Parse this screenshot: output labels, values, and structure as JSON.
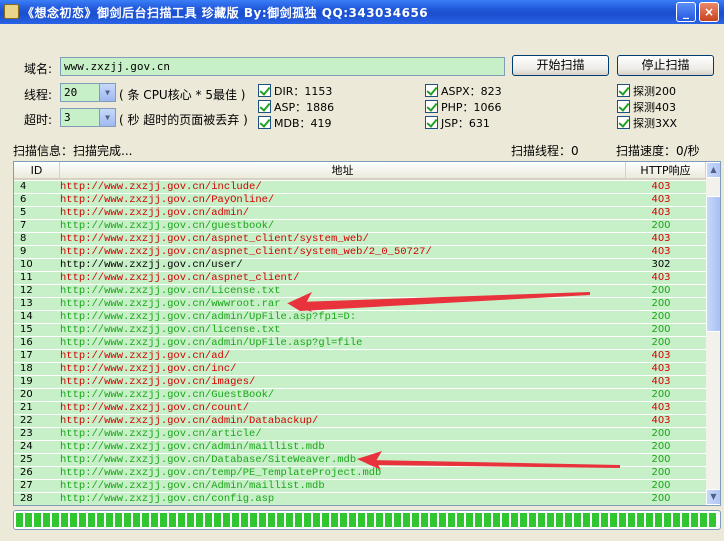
{
  "window": {
    "title": "《想念初恋》御剑后台扫描工具 珍藏版 By:御剑孤独 QQ:343034656",
    "min_label": "_",
    "close_label": "×"
  },
  "form": {
    "domain_label": "域名:",
    "domain_value": "www.zxzjj.gov.cn",
    "threads_label": "线程:",
    "threads_value": "20",
    "threads_hint": "( 条 CPU核心 * 5最佳 )",
    "timeout_label": "超时:",
    "timeout_value": "3",
    "timeout_hint": "( 秒 超时的页面被丢弃 )",
    "start_button": "开始扫描",
    "stop_button": "停止扫描"
  },
  "checkboxes": {
    "dir": "DIR：1153",
    "asp": "ASP：1886",
    "mdb": "MDB：419",
    "aspx": "ASPX：823",
    "php": "PHP：1066",
    "jsp": "JSP：631",
    "probe200": "探测200",
    "probe403": "探测403",
    "probe3xx": "探测3XX"
  },
  "status": {
    "info": "扫描信息：扫描完成...",
    "threads": "扫描线程：0",
    "speed": "扫描速度：0/秒"
  },
  "list": {
    "headers": [
      "ID",
      "地址",
      "HTTP响应"
    ],
    "rows": [
      {
        "id": "4",
        "url": "http://www.zxzjj.gov.cn/include/",
        "code": "403"
      },
      {
        "id": "6",
        "url": "http://www.zxzjj.gov.cn/PayOnline/",
        "code": "403"
      },
      {
        "id": "5",
        "url": "http://www.zxzjj.gov.cn/admin/",
        "code": "403"
      },
      {
        "id": "7",
        "url": "http://www.zxzjj.gov.cn/guestbook/",
        "code": "200"
      },
      {
        "id": "8",
        "url": "http://www.zxzjj.gov.cn/aspnet_client/system_web/",
        "code": "403"
      },
      {
        "id": "9",
        "url": "http://www.zxzjj.gov.cn/aspnet_client/system_web/2_0_50727/",
        "code": "403"
      },
      {
        "id": "10",
        "url": "http://www.zxzjj.gov.cn/user/",
        "code": "302"
      },
      {
        "id": "11",
        "url": "http://www.zxzjj.gov.cn/aspnet_client/",
        "code": "403"
      },
      {
        "id": "12",
        "url": "http://www.zxzjj.gov.cn/License.txt",
        "code": "200"
      },
      {
        "id": "13",
        "url": "http://www.zxzjj.gov.cn/wwwroot.rar",
        "code": "200"
      },
      {
        "id": "14",
        "url": "http://www.zxzjj.gov.cn/admin/UpFile.asp?fp1=D:",
        "code": "200"
      },
      {
        "id": "15",
        "url": "http://www.zxzjj.gov.cn/license.txt",
        "code": "200"
      },
      {
        "id": "16",
        "url": "http://www.zxzjj.gov.cn/admin/UpFile.asp?gl=file",
        "code": "200"
      },
      {
        "id": "17",
        "url": "http://www.zxzjj.gov.cn/ad/",
        "code": "403"
      },
      {
        "id": "18",
        "url": "http://www.zxzjj.gov.cn/inc/",
        "code": "403"
      },
      {
        "id": "19",
        "url": "http://www.zxzjj.gov.cn/images/",
        "code": "403"
      },
      {
        "id": "20",
        "url": "http://www.zxzjj.gov.cn/GuestBook/",
        "code": "200"
      },
      {
        "id": "21",
        "url": "http://www.zxzjj.gov.cn/count/",
        "code": "403"
      },
      {
        "id": "22",
        "url": "http://www.zxzjj.gov.cn/admin/Databackup/",
        "code": "403"
      },
      {
        "id": "23",
        "url": "http://www.zxzjj.gov.cn/article/",
        "code": "200"
      },
      {
        "id": "24",
        "url": "http://www.zxzjj.gov.cn/admin/maillist.mdb",
        "code": "200"
      },
      {
        "id": "25",
        "url": "http://www.zxzjj.gov.cn/Database/SiteWeaver.mdb",
        "code": "200"
      },
      {
        "id": "26",
        "url": "http://www.zxzjj.gov.cn/temp/PE_TemplateProject.mdb",
        "code": "200"
      },
      {
        "id": "27",
        "url": "http://www.zxzjj.gov.cn/Admin/maillist.mdb",
        "code": "200"
      },
      {
        "id": "28",
        "url": "http://www.zxzjj.gov.cn/config.asp",
        "code": "200"
      }
    ]
  },
  "progress": {
    "fraction": 1.0
  },
  "colors": {
    "code_200": "#1aa61a",
    "code_403": "#d40000",
    "code_302": "#000000",
    "row_bg": "#c8f0c8",
    "arrow": "#e8323c"
  },
  "icons": {
    "app": "app-icon",
    "minimize": "minimize-icon",
    "close": "close-icon",
    "dropdown": "chevron-down-icon",
    "scroll_up": "scroll-up-icon",
    "scroll_down": "scroll-down-icon"
  }
}
